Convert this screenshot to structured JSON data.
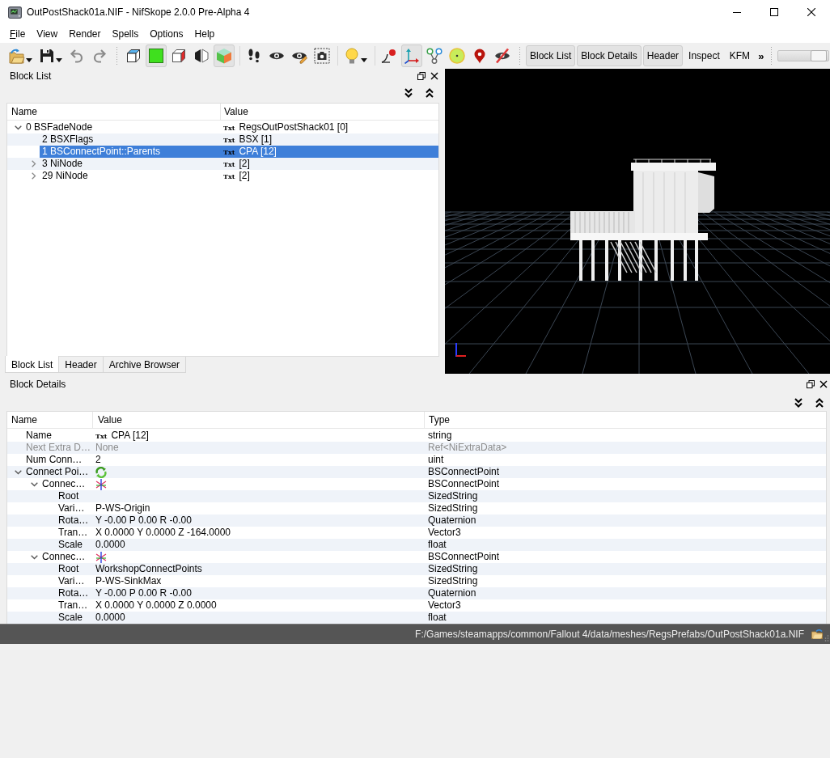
{
  "window": {
    "title": "OutPostShack01a.NIF - NifSkope 2.0.0 Pre-Alpha 4"
  },
  "menu": [
    {
      "label": "File",
      "mnemonic": true
    },
    {
      "label": "View",
      "mnemonic": false
    },
    {
      "label": "Render",
      "mnemonic": false
    },
    {
      "label": "Spells",
      "mnemonic": false
    },
    {
      "label": "Options",
      "mnemonic": false
    },
    {
      "label": "Help",
      "mnemonic": false
    }
  ],
  "toolbar": {
    "icon_bars": [
      {
        "groups": [
          {
            "tools": [
              {
                "pressed": false,
                "menu": true
              },
              {
                "pressed": false,
                "menu": true
              },
              {
                "pressed": false,
                "menu": false
              },
              {
                "pressed": false,
                "menu": false
              }
            ]
          }
        ]
      },
      {
        "groups": [
          {
            "tools": [
              {
                "pressed": false,
                "menu": false
              },
              {
                "pressed": true,
                "menu": false
              },
              {
                "pressed": false,
                "menu": false
              },
              {
                "pressed": false,
                "menu": false
              },
              {
                "pressed": true,
                "menu": false
              }
            ]
          },
          {
            "tools": [
              {
                "pressed": false,
                "menu": false
              },
              {
                "pressed": false,
                "menu": false
              },
              {
                "pressed": false,
                "menu": false
              },
              {
                "pressed": false,
                "menu": false
              }
            ]
          },
          {
            "tools": [
              {
                "pressed": false,
                "menu": true
              }
            ]
          },
          {
            "tools": [
              {
                "pressed": false,
                "menu": false
              },
              {
                "pressed": true,
                "menu": false
              },
              {
                "pressed": false,
                "menu": false
              },
              {
                "pressed": false,
                "menu": false
              },
              {
                "pressed": false,
                "menu": false
              },
              {
                "pressed": false,
                "menu": false
              }
            ]
          }
        ]
      }
    ],
    "dock_buttons": [
      {
        "label": "Block List",
        "checked": true
      },
      {
        "label": "Block Details",
        "checked": true
      },
      {
        "label": "Header",
        "checked": true
      },
      {
        "label": "Inspect",
        "checked": false
      },
      {
        "label": "KFM",
        "checked": false
      }
    ],
    "overflow": "»",
    "slider": {
      "level": 0.95
    }
  },
  "block_list": {
    "title": "Block List",
    "columns": [
      "Name",
      "Value"
    ],
    "rows": [
      {
        "name": "0 BSFadeNode",
        "badge": "Txt",
        "value": "RegsOutPostShack01 [0]",
        "expanded": true,
        "selected": false,
        "children": [
          {
            "name": "2 BSXFlags",
            "badge": "Txt",
            "value": "BSX [1]",
            "selected": false
          },
          {
            "name": "1 BSConnectPoint::Parents",
            "badge": "Txt",
            "value": "CPA [12]",
            "selected": true
          },
          {
            "name": "3 NiNode",
            "badge": "Txt",
            "value": "[2]",
            "expanded": false,
            "selected": false
          },
          {
            "name": "29 NiNode",
            "badge": "Txt",
            "value": "[2]",
            "expanded": false,
            "selected": false
          }
        ]
      }
    ],
    "tabs": [
      {
        "label": "Block List",
        "selected": true
      },
      {
        "label": "Header",
        "selected": false
      },
      {
        "label": "Archive Browser",
        "selected": false
      }
    ]
  },
  "block_details": {
    "title": "Block Details",
    "columns": [
      "Name",
      "Value",
      "Type"
    ],
    "rows": [
      {
        "name": "Name",
        "kind": "field",
        "badge": "Txt",
        "value": "CPA [12]",
        "type": "string",
        "disabled": false
      },
      {
        "name": "Next Extra D…",
        "kind": "field",
        "value": "None",
        "type": "Ref<NiExtraData>",
        "disabled": true
      },
      {
        "name": "Num Conn…",
        "kind": "field",
        "value": "2",
        "type": "uint",
        "disabled": false
      },
      {
        "name": "Connect Poi…",
        "kind": "array",
        "type": "BSConnectPoint",
        "disabled": false,
        "expanded": true,
        "children": [
          {
            "name": "Connec…",
            "kind": "compound",
            "type": "BSConnectPoint",
            "disabled": false,
            "expanded": true,
            "children": [
              {
                "name": "Root",
                "kind": "field",
                "type": "SizedString",
                "disabled": false
              },
              {
                "name": "Vari…",
                "kind": "field",
                "value": "P-WS-Origin",
                "type": "SizedString",
                "disabled": false
              },
              {
                "name": "Rota…",
                "kind": "field",
                "value": "Y -0.00 P 0.00 R -0.00",
                "type": "Quaternion",
                "disabled": false
              },
              {
                "name": "Tran…",
                "kind": "field",
                "value": "X 0.0000 Y 0.0000 Z -164.0000",
                "type": "Vector3",
                "disabled": false
              },
              {
                "name": "Scale",
                "kind": "field",
                "value": "0.0000",
                "type": "float",
                "disabled": false
              }
            ]
          },
          {
            "name": "Connec…",
            "kind": "compound",
            "type": "BSConnectPoint",
            "disabled": false,
            "expanded": true,
            "children": [
              {
                "name": "Root",
                "kind": "field",
                "value": "WorkshopConnectPoints",
                "type": "SizedString",
                "disabled": false
              },
              {
                "name": "Vari…",
                "kind": "field",
                "value": "P-WS-SinkMax",
                "type": "SizedString",
                "disabled": false
              },
              {
                "name": "Rota…",
                "kind": "field",
                "value": "Y -0.00 P 0.00 R -0.00",
                "type": "Quaternion",
                "disabled": false
              },
              {
                "name": "Tran…",
                "kind": "field",
                "value": "X 0.0000 Y 0.0000 Z 0.0000",
                "type": "Vector3",
                "disabled": false
              },
              {
                "name": "Scale",
                "kind": "field",
                "value": "0.0000",
                "type": "float",
                "disabled": false
              }
            ]
          }
        ]
      }
    ]
  },
  "status_bar": {
    "path": "F:/Games/steamapps/common/Fallout 4/data/meshes/RegsPrefabs/OutPostShack01a.NIF"
  }
}
